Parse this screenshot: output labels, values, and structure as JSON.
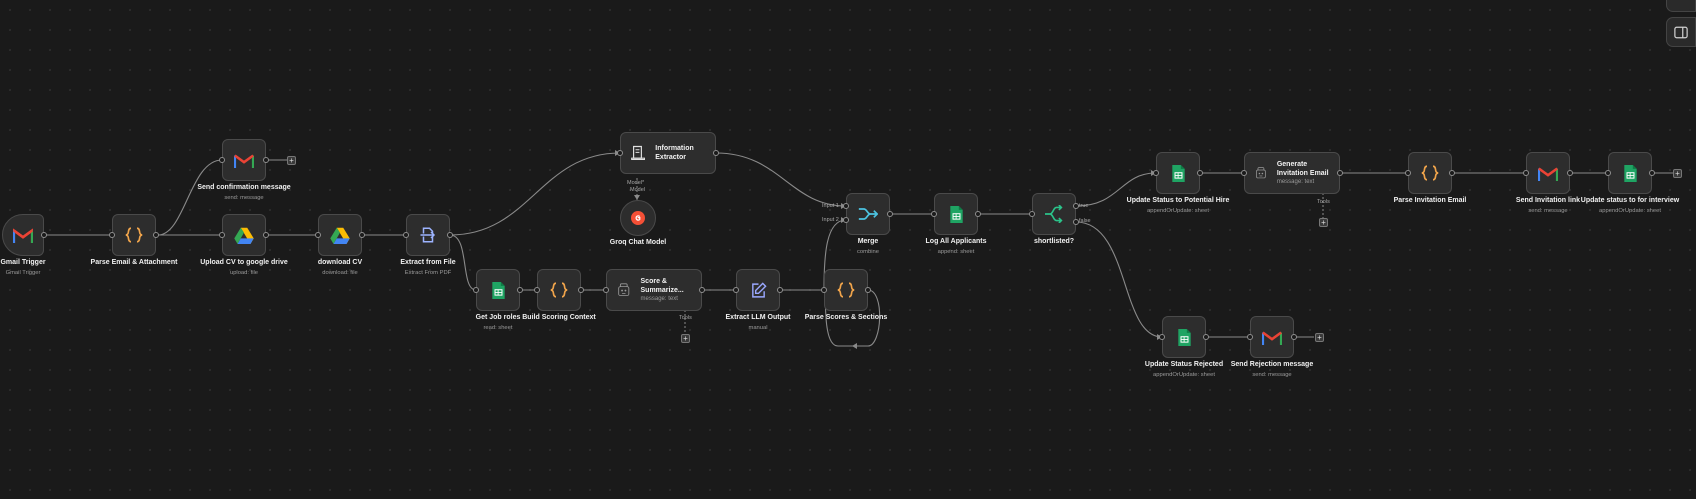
{
  "nodes": {
    "gmail_trigger": {
      "label": "Gmail Trigger",
      "sub": "Gmail Trigger",
      "icon": "gmail-icon"
    },
    "parse_email": {
      "label": "Parse Email & Attachment",
      "icon": "code-braces-icon"
    },
    "send_confirmation": {
      "label": "Send confirmation message",
      "sub": "send: message",
      "icon": "gmail-icon"
    },
    "upload_cv": {
      "label": "Upload CV to google drive",
      "sub": "upload: file",
      "icon": "google-drive-icon"
    },
    "download_cv": {
      "label": "download CV",
      "sub": "download: file",
      "icon": "google-drive-icon"
    },
    "extract_file": {
      "label": "Extract from File",
      "sub": "Extract From PDF",
      "icon": "extract-file-icon"
    },
    "info_extractor": {
      "label": "Information Extractor",
      "icon": "document-icon"
    },
    "groq": {
      "label": "Groq Chat Model",
      "icon": "groq-icon"
    },
    "get_job_roles": {
      "label": "Get Job roles",
      "sub": "read: sheet",
      "icon": "google-sheets-icon"
    },
    "build_scoring": {
      "label": "Build Scoring Context",
      "icon": "code-braces-icon"
    },
    "score_summarize": {
      "label": "Score & Summarize...",
      "sub": "message: text",
      "icon": "openai-icon"
    },
    "extract_llm": {
      "label": "Extract LLM Output",
      "sub": "manual",
      "icon": "edit-pen-icon"
    },
    "parse_scores": {
      "label": "Parse Scores & Sections",
      "icon": "code-braces-icon"
    },
    "merge": {
      "label": "Merge",
      "sub": "combine",
      "icon": "merge-icon"
    },
    "log_applicants": {
      "label": "Log All Applicants",
      "sub": "append: sheet",
      "icon": "google-sheets-icon"
    },
    "shortlisted": {
      "label": "shortlisted?",
      "icon": "if-branch-icon"
    },
    "update_potential": {
      "label": "Update Status to Potential Hire",
      "sub": "appendOrUpdate: sheet",
      "icon": "google-sheets-icon"
    },
    "generate_invitation": {
      "label": "Generate Invitation Email",
      "sub": "message: text",
      "icon": "openai-icon"
    },
    "parse_invitation": {
      "label": "Parse Invitation Email",
      "icon": "code-braces-icon"
    },
    "send_invitation": {
      "label": "Send Invitation link",
      "sub": "send: message",
      "icon": "gmail-icon"
    },
    "update_interview": {
      "label": "Update status to for interview",
      "sub": "appendOrUpdate: sheet",
      "icon": "google-sheets-icon"
    },
    "update_rejected": {
      "label": "Update Status Rejected",
      "sub": "appendOrUpdate: sheet",
      "icon": "google-sheets-icon"
    },
    "send_rejection": {
      "label": "Send Rejection message",
      "sub": "send: message",
      "icon": "gmail-icon"
    }
  },
  "ports": {
    "model": "Model*",
    "model2": "Model",
    "tools": "Tools",
    "input1": "Input 1",
    "input2": "Input 2",
    "true": "true",
    "false": "false"
  },
  "plus_sign": "+",
  "colors": {
    "canvas": "#1a1a1a",
    "node": "#2d2d2d",
    "edge": "#8a8a8a",
    "sheets_green": "#1fa463",
    "code_orange": "#f0a44b",
    "gmail_red": "#ea4335",
    "merge_cyan": "#4cc3e0",
    "if_green": "#2bc38a"
  },
  "side_buttons": [
    "panel-toggle-icon"
  ]
}
